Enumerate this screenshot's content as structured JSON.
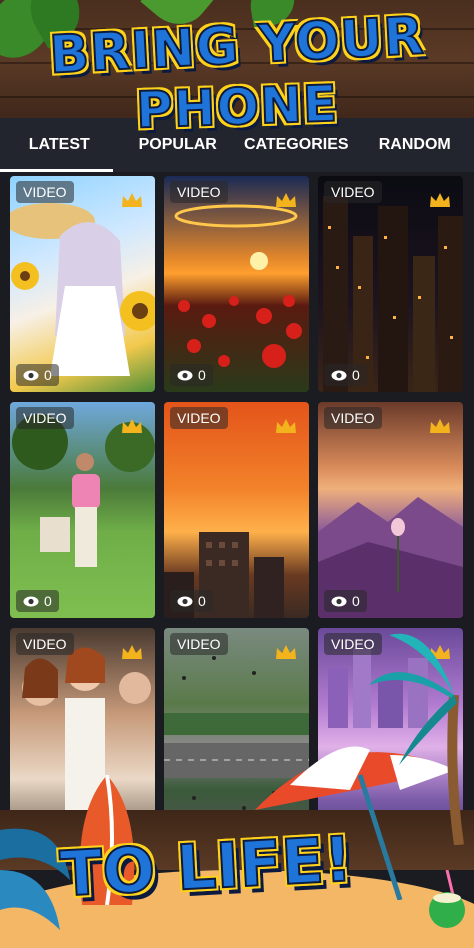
{
  "promo": {
    "top_line1": "BRING YOUR",
    "top_line2": "PHONE",
    "bottom": "TO LIFE!"
  },
  "tabs": [
    {
      "label": "LATEST",
      "active": true
    },
    {
      "label": "POPULAR",
      "active": false
    },
    {
      "label": "CATEGORIES",
      "active": false
    },
    {
      "label": "RANDOM",
      "active": false
    }
  ],
  "cards": [
    {
      "badge": "VIDEO",
      "views": "0",
      "premium_icon": "crown-icon"
    },
    {
      "badge": "VIDEO",
      "views": "0",
      "premium_icon": "crown-icon"
    },
    {
      "badge": "VIDEO",
      "views": "0",
      "premium_icon": "crown-icon"
    },
    {
      "badge": "VIDEO",
      "views": "0",
      "premium_icon": "crown-icon"
    },
    {
      "badge": "VIDEO",
      "views": "0",
      "premium_icon": "crown-icon"
    },
    {
      "badge": "VIDEO",
      "views": "0",
      "premium_icon": "crown-icon"
    },
    {
      "badge": "VIDEO",
      "views": "",
      "premium_icon": "crown-icon"
    },
    {
      "badge": "VIDEO",
      "views": "",
      "premium_icon": "crown-icon"
    },
    {
      "badge": "VIDEO",
      "views": "",
      "premium_icon": "crown-icon"
    }
  ],
  "colors": {
    "tab_bar": "#23252e",
    "crown": "#f2b31c",
    "title_blue": "#1e74d8",
    "title_outline": "#ffd21a"
  }
}
